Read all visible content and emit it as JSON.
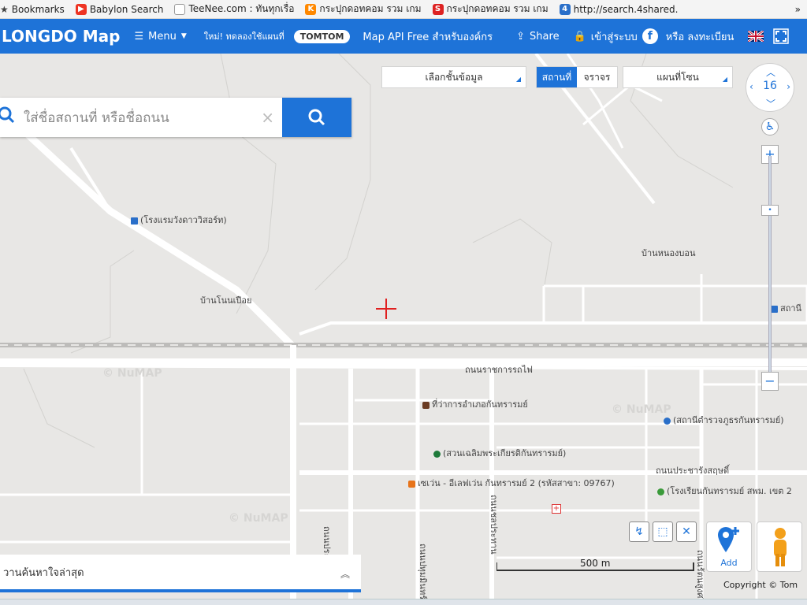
{
  "bookmarks": {
    "items": [
      {
        "label": "Bookmarks",
        "icon": "star-icon"
      },
      {
        "label": "Babylon Search",
        "icon": "youtube-icon"
      },
      {
        "label": "TeeNee.com : ทันทุกเรื่อ",
        "icon": "page-icon"
      },
      {
        "label": "กระปุกดอทคอม รวม เกม",
        "icon": "kapook-icon"
      },
      {
        "label": "กระปุกดอทคอม รวม เกม",
        "icon": "sanook-icon"
      },
      {
        "label": "http://search.4shared.",
        "icon": "4shared-icon"
      }
    ],
    "more": "»"
  },
  "header": {
    "logo": "LONGDO Map",
    "menu": "Menu",
    "promo": "ใหม่! ทดลองใช้แผนที่",
    "tomtom": "TOMTOM",
    "api": "Map API Free สำหรับองค์กร",
    "share": "Share",
    "login": "เข้าสู่ระบบ",
    "or_register": "หรือ ลงทะเบียน"
  },
  "map_controls": {
    "layer_select": "เลือกชั้นข้อมูล",
    "seg_place": "สถานที่",
    "seg_traffic": "จราจร",
    "basemap_select": "แผนที่โซน",
    "zoom_level": "16",
    "zoom_in": "+",
    "zoom_out": "−"
  },
  "search": {
    "placeholder": "ใส่ชื่อสถานที่ หรือชื่อถนน",
    "clear": "×"
  },
  "labels": {
    "hotel": "(โรงแรมวังดาววิสอร์ท)",
    "village1": "บ้านโนนเปือย",
    "village2": "บ้านหนองบอน",
    "station": "สถานี",
    "road_rail": "ถนนราชการรถไฟ",
    "district_office": "ที่ว่าการอำเภอกันทรารมย์",
    "police": "(สถานีตำรวจภูธรกันทรารมย์)",
    "park": "(สวนเฉลิมพระเกียรติกันทรารมย์)",
    "seven": "เซเว่น - อีเลฟเว่น กันทรารมย์ 2 (รหัสสาขา: 09767)",
    "road_pracha": "ถนนประชารังสฤษดิ์",
    "school": "(โรงเรียนกันทรารมย์ สพม. เขต 2",
    "road_v1": "ถนนประชาสุข",
    "road_v2": "ถนนชลประทาน",
    "road_v3": "ถนนปทุมมินทร์",
    "road_v4": "ถนนรัตนสูงศรี",
    "road_v5": "ถนนสายหลัก",
    "watermark": "© NuMAP"
  },
  "tools": {
    "add": "Add",
    "scale": "500 m",
    "copyright": "Copyright © Tom"
  },
  "recent": {
    "label": "วานค้นหาใจล่าสุด",
    "toggle": "»"
  },
  "colors": {
    "brand": "#1e73d8",
    "map_bg": "#e8e7e5",
    "road": "#ffffff",
    "pin": "#e02020"
  }
}
